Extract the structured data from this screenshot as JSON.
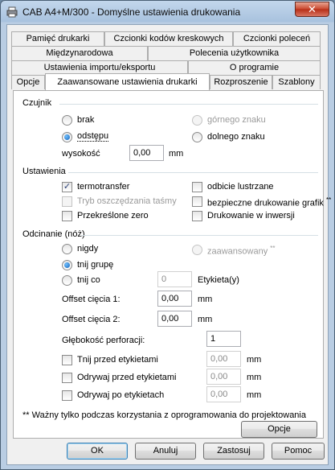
{
  "window": {
    "title": "CAB A4+M/300 - Domyślne ustawienia drukowania",
    "close_glyph": "✕",
    "app_icon": "printer-icon"
  },
  "tabs": {
    "row1": [
      "Pamięć drukarki",
      "Czcionki kodów kreskowych",
      "Czcionki poleceń"
    ],
    "row2": [
      "Międzynarodowa",
      "Polecenia użytkownika"
    ],
    "row3": [
      "Ustawienia importu/eksportu",
      "O programie"
    ],
    "row4": [
      "Opcje",
      "Zaawansowane ustawienia drukarki",
      "Rozproszenie",
      "Szablony"
    ],
    "active": "Zaawansowane ustawienia drukarki"
  },
  "sensor": {
    "title": "Czujnik",
    "opt_none": "brak",
    "opt_gap": "odstępu",
    "opt_top": "górnego znaku",
    "opt_bottom": "dolnego znaku",
    "height_label": "wysokość",
    "height_value": "0,00",
    "unit": "mm"
  },
  "settings": {
    "title": "Ustawienia",
    "thermal": "termotransfer",
    "mirror": "odbicie lustrzane",
    "ribbon_save": "Tryb oszczędzania taśmy",
    "safe_graphics": "bezpieczne drukowanie grafik",
    "safe_graphics_mark": "**",
    "slashed_zero": "Przekreślone zero",
    "inverse": "Drukowanie w inwersji"
  },
  "cutting": {
    "title": "Odcinanie (nóż)",
    "never": "nigdy",
    "advanced": "zaawansowany",
    "advanced_mark": "**",
    "cut_group": "tnij grupę",
    "cut_every": "tnij co",
    "every_value": "0",
    "labels_suffix": "Etykieta(y)",
    "offset1_label": "Offset cięcia 1:",
    "offset1_value": "0,00",
    "offset2_label": "Offset cięcia 2:",
    "offset2_value": "0,00",
    "perf_label": "Głębokość perforacji:",
    "perf_value": "1",
    "cut_before": "Tnij przed etykietami",
    "cut_before_value": "0,00",
    "tear_before": "Odrywaj przed etykietami",
    "tear_before_value": "0,00",
    "tear_after": "Odrywaj po etykietach",
    "tear_after_value": "0,00",
    "unit": "mm"
  },
  "footnote": "** Ważny tylko podczas korzystania z oprogramowania do projektowania etykiet",
  "options_button": "Opcje",
  "buttons": {
    "ok": "OK",
    "cancel": "Anuluj",
    "apply": "Zastosuj",
    "help": "Pomoc"
  },
  "colors": {
    "close_button": "#c9452b",
    "radio_dot": "#1763b7",
    "check_mark": "#2a3f77",
    "page_bg": "#ffffff",
    "dialog_bg": "#f0f0f0"
  }
}
